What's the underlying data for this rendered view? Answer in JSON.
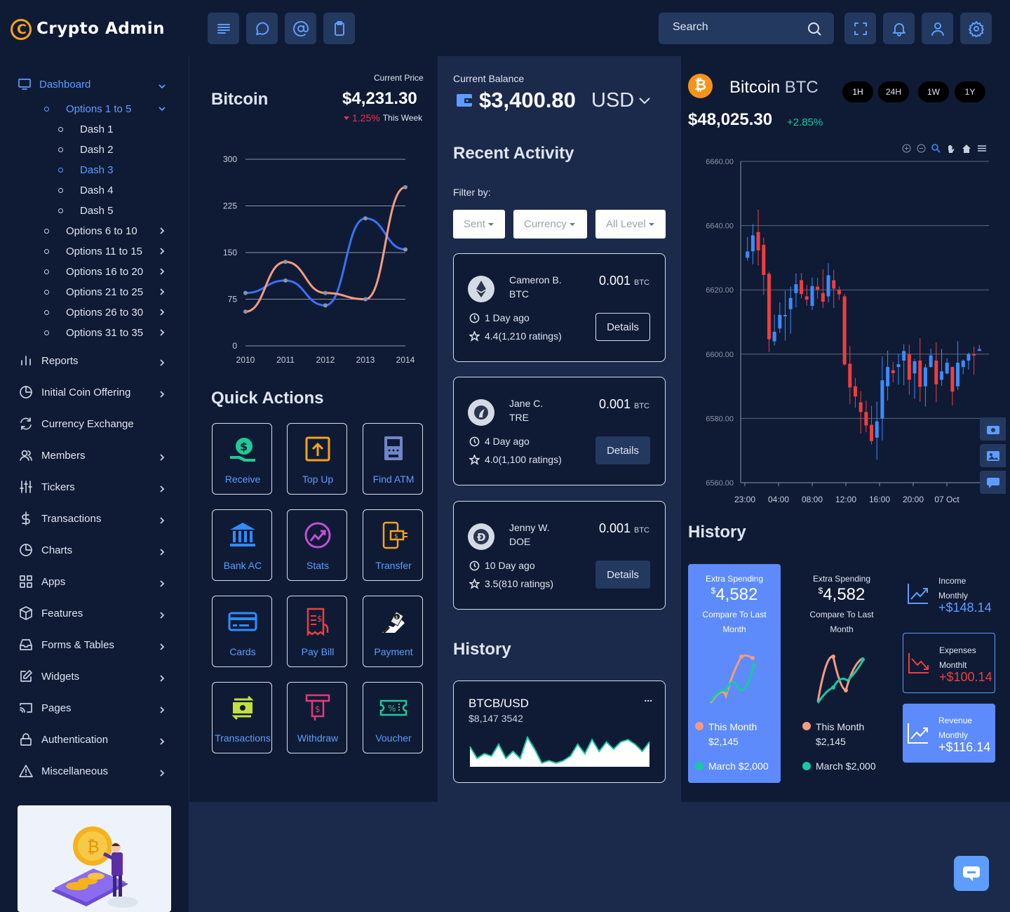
{
  "app": {
    "title": "Crypto Admin"
  },
  "search": {
    "placeholder": "Search"
  },
  "sidebar": {
    "dashboard": "Dashboard",
    "options_group": "Options 1 to 5",
    "dash_items": [
      "Dash 1",
      "Dash 2",
      "Dash 3",
      "Dash 4",
      "Dash 5"
    ],
    "option_groups": [
      "Options 6 to 10",
      "Options 11 to 15",
      "Options 16 to 20",
      "Options 21 to 25",
      "Options 26 to 30",
      "Options 31 to 35"
    ],
    "items": [
      "Reports",
      "Initial Coin Offering",
      "Currency Exchange",
      "Members",
      "Tickers",
      "Transactions",
      "Charts",
      "Apps",
      "Features",
      "Forms & Tables",
      "Widgets",
      "Pages",
      "Authentication",
      "Miscellaneous"
    ]
  },
  "price_card": {
    "title": "Bitcoin",
    "current_price_label": "Current Price",
    "price": "$4,231.30",
    "change": "1.25%",
    "change_suffix": "This Week",
    "change_color": "#ee3158"
  },
  "chart_data": [
    {
      "type": "line",
      "categories": [
        "2010",
        "2011",
        "2012",
        "2013",
        "2014"
      ],
      "ylim": [
        0,
        300
      ],
      "yticks": [
        "300",
        "225",
        "150",
        "75",
        "0"
      ],
      "series": [
        {
          "values": [
            85,
            105,
            65,
            205,
            155
          ],
          "color": "#3b71f7"
        },
        {
          "values": [
            55,
            135,
            85,
            75,
            255
          ],
          "color": "#f49b7f"
        }
      ]
    },
    {
      "type": "candlestick",
      "title": "Bitcoin BTC",
      "x_ticks": [
        "23:00",
        "04:00",
        "08:00",
        "12:00",
        "16:00",
        "20:00",
        "07 Oct"
      ],
      "yticks": [
        "6660.00",
        "6640.00",
        "6620.00",
        "6600.00",
        "6580.00",
        "6560.00"
      ],
      "ylim": [
        6560,
        6660
      ],
      "up_color": "#3b8cff",
      "down_color": "#ef3e3e"
    },
    {
      "type": "area",
      "title": "BTCB/USD",
      "values": [
        8,
        3,
        5,
        4,
        9,
        3,
        6,
        3,
        12,
        7,
        1,
        2,
        1,
        2,
        4,
        9,
        5,
        11,
        6,
        10,
        7,
        10,
        11,
        9,
        6,
        10
      ]
    }
  ],
  "quick_actions": {
    "title": "Quick Actions",
    "items": [
      "Receive",
      "Top Up",
      "Find ATM",
      "Bank AC",
      "Stats",
      "Transfer",
      "Cards",
      "Pay Bill",
      "Payment",
      "Transactions",
      "Withdraw",
      "Voucher"
    ]
  },
  "balance": {
    "label": "Current Balance",
    "amount": "$3,400.80",
    "currency": "USD"
  },
  "activity": {
    "title": "Recent Activity",
    "filter_label": "Filter by:",
    "filters": [
      "Sent",
      "Currency",
      "All Level"
    ],
    "items": [
      {
        "name": "Cameron B.",
        "coin": "BTC",
        "amount": "0.001",
        "unit": "BTC",
        "time": "1 Day ago",
        "rating": "4.4(1,210 ratings)",
        "button": "Details"
      },
      {
        "name": "Jane C.",
        "coin": "TRE",
        "amount": "0.001",
        "unit": "BTC",
        "time": "4 Day ago",
        "rating": "4.0(1,100 ratings)",
        "button": "Details"
      },
      {
        "name": "Jenny W.",
        "coin": "DOE",
        "amount": "0.001",
        "unit": "BTC",
        "time": "10 Day ago",
        "rating": "3.5(810 ratings)",
        "button": "Details"
      }
    ]
  },
  "history_mid": {
    "title": "History",
    "pair": "BTCB/USD",
    "value": "$8,147 3542",
    "menu": "..."
  },
  "btc": {
    "name": "Bitcoin",
    "symbol": "BTC",
    "price": "$48,025.30",
    "change": "+2.85%",
    "timeframes": [
      "1H",
      "24H",
      "1W",
      "1Y"
    ]
  },
  "history_right": {
    "title": "History",
    "cards": [
      {
        "label": "Extra Spending",
        "currency": "$",
        "amount": "4,582",
        "compare": "Compare To Last Month",
        "this_month": "This Month",
        "this_month_value": "$2,145",
        "march": "March $2,000"
      },
      {
        "label": "Extra Spending",
        "currency": "$",
        "amount": "4,582",
        "compare": "Compare To Last Month",
        "this_month": "This Month",
        "this_month_value": "$2,145",
        "march": "March $2,000"
      }
    ],
    "stats": [
      {
        "label1": "Income",
        "label2": "Monthly",
        "value": "+$148.14"
      },
      {
        "label1": "Expenses",
        "label2": "Monthlt",
        "value": "+$100.14"
      },
      {
        "label1": "Revenue",
        "label2": "Monthly",
        "value": "+$116.14"
      }
    ]
  },
  "colors": {
    "accent": "#5d9dff",
    "bg": "#0f1b35",
    "panel": "#1b2a4b",
    "teal": "#17c9a5",
    "peach": "#f49b7f"
  }
}
